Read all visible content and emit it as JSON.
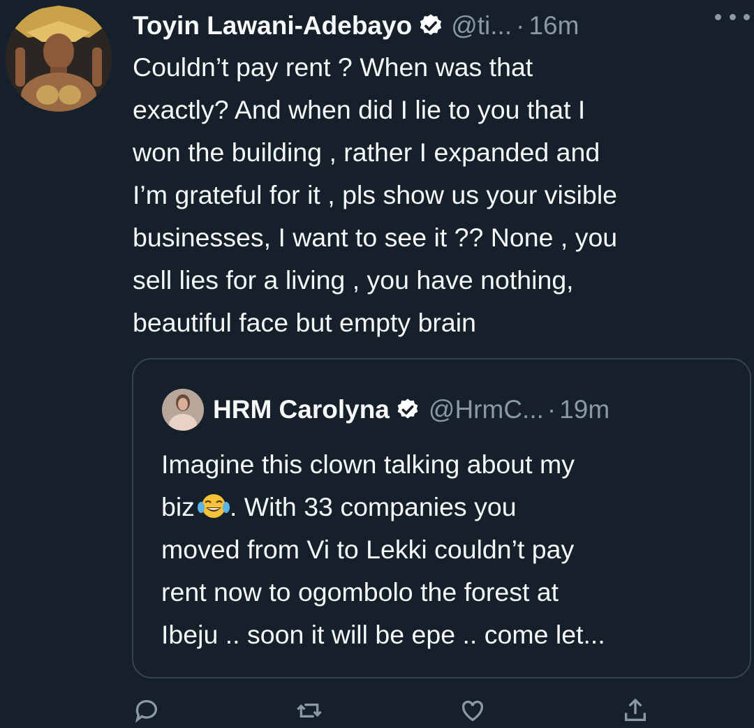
{
  "tweet": {
    "author_name": "Toyin Lawani-Adebayo",
    "handle": "@ti...",
    "separator": "·",
    "time": "16m",
    "text": "Couldn’t pay rent ? When was that\nexactly? And when did I lie to you that I\nwon the building , rather I expanded and\nI’m grateful for it , pls show us your visible\nbusinesses, I want to see it ?? None , you\nsell lies for a living , you have nothing,\nbeautiful face but empty brain",
    "avatar_icon": "profile-avatar-gold-headdress",
    "verified_icon": "verified-badge-icon",
    "more_icon": "more-options-icon"
  },
  "quoted_tweet": {
    "author_name": "HRM Carolyna",
    "handle": "@HrmC...",
    "separator": "·",
    "time": "19m",
    "text_before_emoji": "Imagine this clown talking about my\nbiz",
    "emoji_icon": "face-with-tears-of-joy-emoji",
    "text_after_emoji": ". With 33 companies you\nmoved from Vi to Lekki couldn’t pay\nrent now to ogombolo the forest at\nIbeju .. soon it will be epe .. come let..."
  },
  "actions": [
    {
      "icon": "reply-icon"
    },
    {
      "icon": "retweet-icon"
    },
    {
      "icon": "like-icon"
    },
    {
      "icon": "share-icon"
    }
  ],
  "colors": {
    "background": "#15202b",
    "text_primary": "#f7f9f9",
    "text_secondary": "#8b98a5",
    "border": "#38444d",
    "verified_badge": "#ffffff"
  }
}
